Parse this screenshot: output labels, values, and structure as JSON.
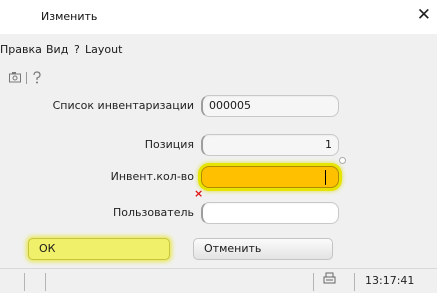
{
  "window": {
    "title": "Изменить",
    "close_glyph": "✕"
  },
  "menu": {
    "items": [
      "Правка",
      "Вид",
      "?",
      "Layout"
    ]
  },
  "toolbar": {
    "icons": [
      "screenshot-icon",
      "help-icon"
    ]
  },
  "form": {
    "inventory_list": {
      "label": "Список инвентаризации",
      "value": "000005"
    },
    "position": {
      "label": "Позиция",
      "value": "1"
    },
    "count": {
      "label": "Инвент.кол-во",
      "value": "",
      "state": "active",
      "highlight_color": "#ffc000",
      "error_mark": "×"
    },
    "user": {
      "label": "Пользователь",
      "value": ""
    }
  },
  "buttons": {
    "ok": "ОК",
    "cancel": "Отменить"
  },
  "statusbar": {
    "time": "13:17:41",
    "icon": "printer-icon"
  }
}
